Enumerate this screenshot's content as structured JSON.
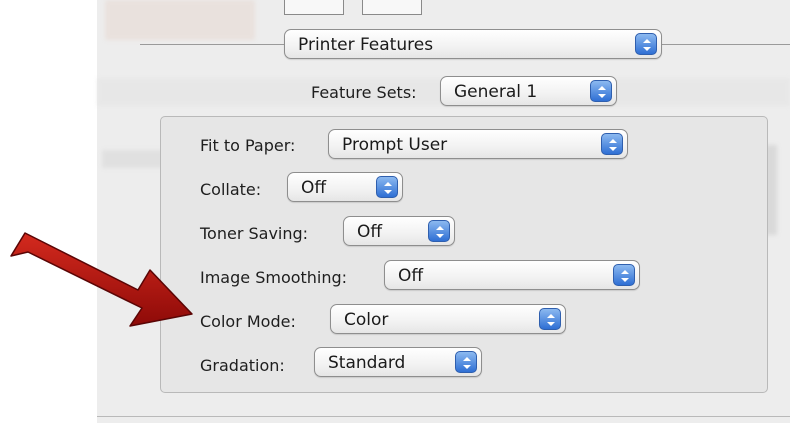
{
  "dialog": {
    "pane_menu": {
      "value": "Printer Features"
    },
    "feature_sets": {
      "label": "Feature Sets:",
      "value": "General 1"
    }
  },
  "options": [
    {
      "label": "Fit to Paper:",
      "value": "Prompt User"
    },
    {
      "label": "Collate:",
      "value": "Off"
    },
    {
      "label": "Toner Saving:",
      "value": "Off"
    },
    {
      "label": "Image Smoothing:",
      "value": "Off"
    },
    {
      "label": "Color Mode:",
      "value": "Color"
    },
    {
      "label": "Gradation:",
      "value": "Standard"
    }
  ],
  "colors": {
    "arrow_fill": "#b81010",
    "stepper_blue": "#2f6fd4"
  },
  "icons": [
    "popup-stepper-icon",
    "annotation-arrow-icon"
  ]
}
